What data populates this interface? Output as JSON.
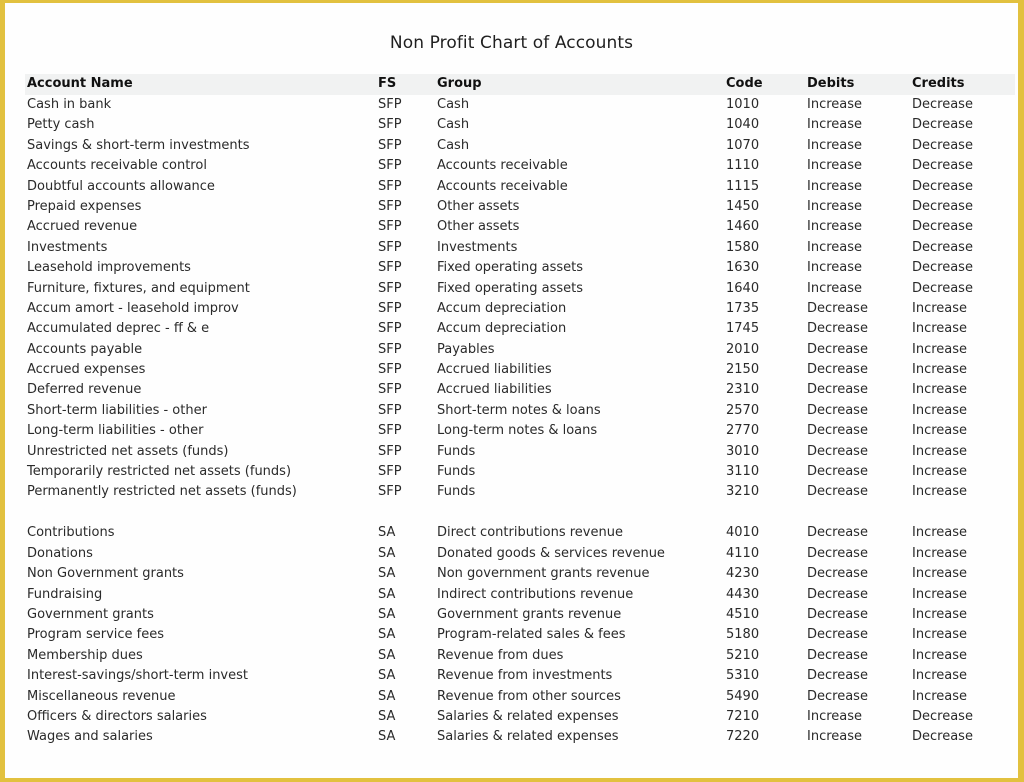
{
  "title": "Non Profit Chart of Accounts",
  "columns": {
    "name": "Account Name",
    "fs": "FS",
    "group": "Group",
    "code": "Code",
    "debits": "Debits",
    "credits": "Credits"
  },
  "colors": {
    "frame": "#e2c13f",
    "header_bg": "#f1f2f2"
  },
  "sfp_rows": [
    {
      "name": "Cash in bank",
      "fs": "SFP",
      "group": "Cash",
      "code": "1010",
      "debits": "Increase",
      "credits": "Decrease"
    },
    {
      "name": "Petty cash",
      "fs": "SFP",
      "group": "Cash",
      "code": "1040",
      "debits": "Increase",
      "credits": "Decrease"
    },
    {
      "name": "Savings & short-term investments",
      "fs": "SFP",
      "group": "Cash",
      "code": "1070",
      "debits": "Increase",
      "credits": "Decrease"
    },
    {
      "name": "Accounts receivable control",
      "fs": "SFP",
      "group": "Accounts receivable",
      "code": "1110",
      "debits": "Increase",
      "credits": "Decrease"
    },
    {
      "name": "Doubtful accounts allowance",
      "fs": "SFP",
      "group": "Accounts receivable",
      "code": "1115",
      "debits": "Increase",
      "credits": "Decrease"
    },
    {
      "name": "Prepaid expenses",
      "fs": "SFP",
      "group": "Other assets",
      "code": "1450",
      "debits": "Increase",
      "credits": "Decrease"
    },
    {
      "name": "Accrued revenue",
      "fs": "SFP",
      "group": "Other assets",
      "code": "1460",
      "debits": "Increase",
      "credits": "Decrease"
    },
    {
      "name": "Investments",
      "fs": "SFP",
      "group": "Investments",
      "code": "1580",
      "debits": "Increase",
      "credits": "Decrease"
    },
    {
      "name": "Leasehold improvements",
      "fs": "SFP",
      "group": "Fixed operating assets",
      "code": "1630",
      "debits": "Increase",
      "credits": "Decrease"
    },
    {
      "name": "Furniture, fixtures, and equipment",
      "fs": "SFP",
      "group": "Fixed operating assets",
      "code": "1640",
      "debits": "Increase",
      "credits": "Decrease"
    },
    {
      "name": "Accum amort - leasehold improv",
      "fs": "SFP",
      "group": "Accum depreciation",
      "code": "1735",
      "debits": "Decrease",
      "credits": "Increase"
    },
    {
      "name": "Accumulated deprec - ff & e",
      "fs": "SFP",
      "group": "Accum depreciation",
      "code": "1745",
      "debits": "Decrease",
      "credits": "Increase"
    },
    {
      "name": "Accounts payable",
      "fs": "SFP",
      "group": "Payables",
      "code": "2010",
      "debits": "Decrease",
      "credits": "Increase"
    },
    {
      "name": "Accrued expenses",
      "fs": "SFP",
      "group": "Accrued liabilities",
      "code": "2150",
      "debits": "Decrease",
      "credits": "Increase"
    },
    {
      "name": "Deferred revenue",
      "fs": "SFP",
      "group": "Accrued liabilities",
      "code": "2310",
      "debits": "Decrease",
      "credits": "Increase"
    },
    {
      "name": "Short-term liabilities - other",
      "fs": "SFP",
      "group": "Short-term notes & loans",
      "code": "2570",
      "debits": "Decrease",
      "credits": "Increase"
    },
    {
      "name": "Long-term liabilities - other",
      "fs": "SFP",
      "group": "Long-term notes & loans",
      "code": "2770",
      "debits": "Decrease",
      "credits": "Increase"
    },
    {
      "name": "Unrestricted net assets (funds)",
      "fs": "SFP",
      "group": "Funds",
      "code": "3010",
      "debits": "Decrease",
      "credits": "Increase"
    },
    {
      "name": "Temporarily restricted  net assets (funds)",
      "fs": "SFP",
      "group": "Funds",
      "code": "3110",
      "debits": "Decrease",
      "credits": "Increase"
    },
    {
      "name": "Permanently restricted net assets (funds)",
      "fs": "SFP",
      "group": "Funds",
      "code": "3210",
      "debits": "Decrease",
      "credits": "Increase"
    }
  ],
  "sa_rows": [
    {
      "name": "Contributions",
      "fs": "SA",
      "group": "Direct contributions revenue",
      "code": "4010",
      "debits": "Decrease",
      "credits": "Increase"
    },
    {
      "name": "Donations",
      "fs": "SA",
      "group": "Donated goods & services revenue",
      "code": "4110",
      "debits": "Decrease",
      "credits": "Increase"
    },
    {
      "name": "Non Government grants",
      "fs": "SA",
      "group": "Non government grants revenue",
      "code": "4230",
      "debits": "Decrease",
      "credits": "Increase"
    },
    {
      "name": "Fundraising",
      "fs": "SA",
      "group": "Indirect contributions revenue",
      "code": "4430",
      "debits": "Decrease",
      "credits": "Increase"
    },
    {
      "name": "Government grants",
      "fs": "SA",
      "group": "Government grants revenue",
      "code": "4510",
      "debits": "Decrease",
      "credits": "Increase"
    },
    {
      "name": "Program service fees",
      "fs": "SA",
      "group": "Program-related sales & fees",
      "code": "5180",
      "debits": "Decrease",
      "credits": "Increase"
    },
    {
      "name": "Membership dues",
      "fs": "SA",
      "group": "Revenue from dues",
      "code": "5210",
      "debits": "Decrease",
      "credits": "Increase"
    },
    {
      "name": "Interest-savings/short-term invest",
      "fs": "SA",
      "group": "Revenue from investments",
      "code": "5310",
      "debits": "Decrease",
      "credits": "Increase"
    },
    {
      "name": "Miscellaneous revenue",
      "fs": "SA",
      "group": "Revenue from other sources",
      "code": "5490",
      "debits": "Decrease",
      "credits": "Increase"
    },
    {
      "name": "Officers & directors salaries",
      "fs": "SA",
      "group": "Salaries & related expenses",
      "code": "7210",
      "debits": "Increase",
      "credits": "Decrease"
    },
    {
      "name": "Wages and salaries",
      "fs": "SA",
      "group": "Salaries & related expenses",
      "code": "7220",
      "debits": "Increase",
      "credits": "Decrease"
    }
  ]
}
